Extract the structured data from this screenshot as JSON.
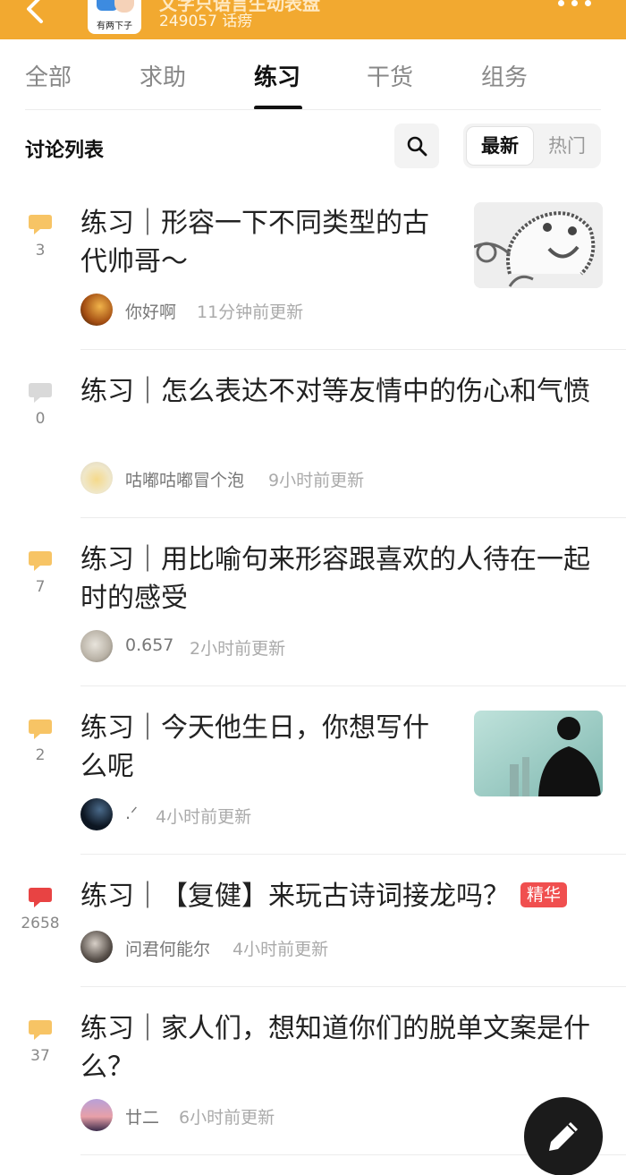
{
  "header": {
    "title": "文字只语言生动表盘",
    "count": "249057 话痨",
    "logo_text": "有两下子"
  },
  "tabs": [
    {
      "label": "全部"
    },
    {
      "label": "求助"
    },
    {
      "label": "练习"
    },
    {
      "label": "干货"
    },
    {
      "label": "组务"
    }
  ],
  "active_tab": "练习",
  "list": {
    "title": "讨论列表",
    "sort": {
      "selected": "最新",
      "other": "热门"
    }
  },
  "posts": [
    {
      "comments": "3",
      "comment_color": "#f7c465",
      "title": "练习｜形容一下不同类型的古代帅哥～",
      "author": "你好啊",
      "time": "11分钟前更新",
      "has_thumb": true
    },
    {
      "comments": "0",
      "comment_color": "#d9d9d9",
      "title": "练习｜怎么表达不对等友情中的伤心和气愤",
      "author": "咕嘟咕嘟冒个泡",
      "time": "9小时前更新",
      "has_thumb": false
    },
    {
      "comments": "7",
      "comment_color": "#f7c465",
      "title": "练习｜用比喻句来形容跟喜欢的人待在一起时的感受",
      "author": "0.657",
      "time": "2小时前更新",
      "has_thumb": false
    },
    {
      "comments": "2",
      "comment_color": "#f7c465",
      "title": "练习｜今天他生日，你想写什么呢",
      "author": ".ᐟ",
      "time": "4小时前更新",
      "has_thumb": true
    },
    {
      "comments": "2658",
      "comment_color": "#e84343",
      "title": "练习｜【复健】来玩古诗词接龙吗？",
      "tag": "精华",
      "author": "问君何能尔",
      "time": "4小时前更新",
      "has_thumb": false
    },
    {
      "comments": "37",
      "comment_color": "#f7c465",
      "title": "练习｜家人们，想知道你们的脱单文案是什么？",
      "author": "廿二",
      "time": "6小时前更新",
      "has_thumb": false
    }
  ],
  "colors": {
    "header_bg": "#f2a930",
    "hot_tag": "#f04f4f",
    "fab_bg": "#1b1b1b"
  },
  "icons": {
    "back": "chevron-left-icon",
    "more": "more-dots-icon",
    "search": "search-icon",
    "comment": "comment-bubble-icon",
    "compose": "pen-icon"
  }
}
